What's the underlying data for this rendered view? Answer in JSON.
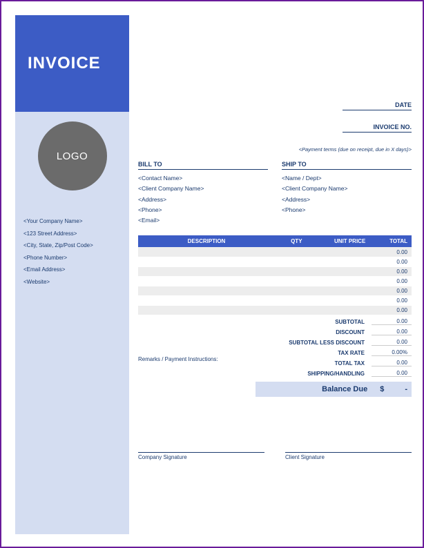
{
  "sidebar": {
    "title": "INVOICE",
    "logo": "LOGO",
    "company": [
      "<Your Company Name>",
      "<123 Street Address>",
      "<City, State, Zip/Post Code>",
      "<Phone Number>",
      "<Email Address>",
      "<Website>"
    ]
  },
  "meta": {
    "date_label": "DATE",
    "invoice_no_label": "INVOICE NO.",
    "terms": "<Payment terms (due on receipt, due in X days)>"
  },
  "bill_to": {
    "heading": "BILL TO",
    "lines": [
      "<Contact Name>",
      "<Client Company Name>",
      "<Address>",
      "<Phone>",
      "<Email>"
    ]
  },
  "ship_to": {
    "heading": "SHIP TO",
    "lines": [
      "<Name / Dept>",
      "<Client Company Name>",
      "<Address>",
      "<Phone>"
    ]
  },
  "table": {
    "headers": [
      "DESCRIPTION",
      "QTY",
      "UNIT PRICE",
      "TOTAL"
    ],
    "rows": [
      {
        "desc": "",
        "qty": "",
        "unit": "",
        "total": "0.00"
      },
      {
        "desc": "",
        "qty": "",
        "unit": "",
        "total": "0.00"
      },
      {
        "desc": "",
        "qty": "",
        "unit": "",
        "total": "0.00"
      },
      {
        "desc": "",
        "qty": "",
        "unit": "",
        "total": "0.00"
      },
      {
        "desc": "",
        "qty": "",
        "unit": "",
        "total": "0.00"
      },
      {
        "desc": "",
        "qty": "",
        "unit": "",
        "total": "0.00"
      },
      {
        "desc": "",
        "qty": "",
        "unit": "",
        "total": "0.00"
      }
    ]
  },
  "remarks": "Remarks / Payment Instructions:",
  "summary": [
    {
      "label": "SUBTOTAL",
      "value": "0.00"
    },
    {
      "label": "DISCOUNT",
      "value": "0.00"
    },
    {
      "label": "SUBTOTAL LESS DISCOUNT",
      "value": "0.00"
    },
    {
      "label": "TAX RATE",
      "value": "0.00%"
    },
    {
      "label": "TOTAL TAX",
      "value": "0.00"
    },
    {
      "label": "SHIPPING/HANDLING",
      "value": "0.00"
    }
  ],
  "balance": {
    "label": "Balance Due",
    "currency": "$",
    "value": "-"
  },
  "signatures": {
    "company": "Company Signature",
    "client": "Client Signature"
  }
}
